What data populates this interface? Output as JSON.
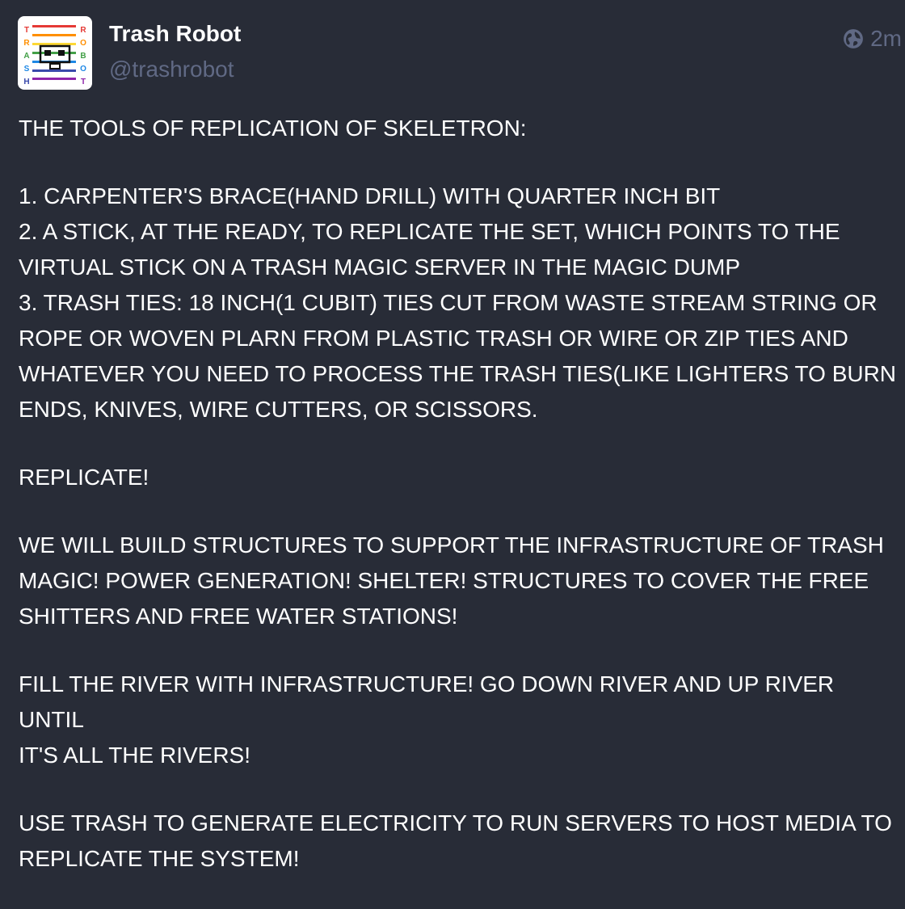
{
  "status": {
    "account": {
      "display_name": "Trash Robot",
      "handle": "@trashrobot",
      "avatar": {
        "left_letters": [
          "T",
          "R",
          "A",
          "S",
          "H"
        ],
        "right_letters": [
          "R",
          "O",
          "B",
          "O",
          "T"
        ]
      }
    },
    "visibility_icon": "globe-icon",
    "timestamp": "2m",
    "paragraphs": [
      {
        "lines": [
          "THE TOOLS OF REPLICATION OF SKELETRON:"
        ]
      },
      {
        "lines": [
          "1. CARPENTER'S BRACE(HAND DRILL) WITH QUARTER INCH BIT",
          "2. A STICK, AT THE READY, TO REPLICATE THE SET, WHICH POINTS TO THE",
          "VIRTUAL STICK ON A TRASH MAGIC SERVER IN THE MAGIC DUMP",
          "3. TRASH TIES: 18 INCH(1 CUBIT) TIES CUT FROM WASTE STREAM STRING OR",
          "ROPE OR WOVEN PLARN FROM PLASTIC TRASH OR WIRE OR ZIP TIES AND",
          "WHATEVER YOU NEED TO PROCESS THE TRASH TIES(LIKE LIGHTERS TO BURN",
          "ENDS, KNIVES, WIRE CUTTERS, OR SCISSORS."
        ]
      },
      {
        "lines": [
          "REPLICATE!"
        ]
      },
      {
        "lines": [
          "WE WILL BUILD STRUCTURES TO SUPPORT THE INFRASTRUCTURE OF TRASH",
          "MAGIC!  POWER GENERATION! SHELTER!  STRUCTURES TO COVER THE FREE",
          "SHITTERS AND FREE WATER STATIONS!"
        ]
      },
      {
        "lines": [
          "FILL THE RIVER WITH INFRASTRUCTURE!  GO DOWN RIVER AND UP RIVER UNTIL",
          "IT'S ALL THE RIVERS!"
        ]
      },
      {
        "lines": [
          "USE TRASH TO GENERATE ELECTRICITY TO RUN SERVERS TO HOST MEDIA TO",
          "REPLICATE THE SYSTEM!"
        ]
      }
    ],
    "colors": {
      "background": "#282c37",
      "text": "#ffffff",
      "muted": "#606984",
      "rainbow": [
        "#e53935",
        "#ff8f00",
        "#fdd835",
        "#43a047",
        "#1e88e5",
        "#3949ab",
        "#8e24aa"
      ]
    }
  }
}
